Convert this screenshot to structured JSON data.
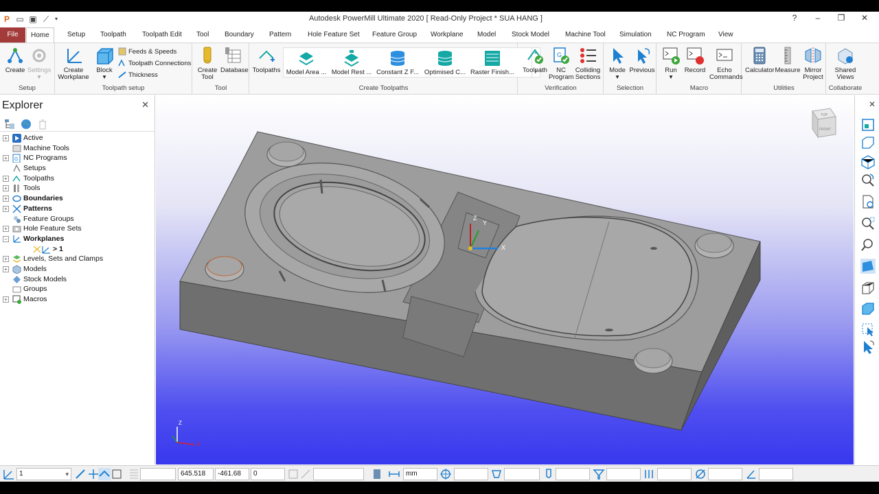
{
  "app": {
    "title": "Autodesk PowerMill Ultimate 2020    [ Read-Only Project * SUA HANG ]",
    "window_buttons": [
      "?",
      "–",
      "❐",
      "✕"
    ]
  },
  "tabs": [
    {
      "label": "File"
    },
    {
      "label": "Home"
    },
    {
      "label": "Setup"
    },
    {
      "label": "Toolpath"
    },
    {
      "label": "Toolpath Edit"
    },
    {
      "label": "Tool"
    },
    {
      "label": "Boundary"
    },
    {
      "label": "Pattern"
    },
    {
      "label": "Hole Feature Set"
    },
    {
      "label": "Feature Group"
    },
    {
      "label": "Workplane"
    },
    {
      "label": "Model"
    },
    {
      "label": "Stock Model"
    },
    {
      "label": "Machine Tool"
    },
    {
      "label": "Simulation"
    },
    {
      "label": "NC Program"
    },
    {
      "label": "View"
    }
  ],
  "ribbon": {
    "setup": {
      "label": "Setup",
      "create": "Create",
      "settings": "Settings"
    },
    "toolpath_setup": {
      "label": "Toolpath setup",
      "create_workplane": [
        "Create",
        "Workplane"
      ],
      "block": "Block",
      "feeds": "Feeds & Speeds",
      "connections": "Toolpath Connections",
      "thickness": "Thickness"
    },
    "tool": {
      "label": "Tool",
      "create_tool": [
        "Create",
        "Tool"
      ],
      "database": "Database"
    },
    "create_toolpaths": {
      "label": "Create Toolpaths",
      "toolpaths": "Toolpaths",
      "gallery": [
        "Model Area ...",
        "Model Rest ...",
        "Constant Z F...",
        "Optimised C...",
        "Raster Finish..."
      ]
    },
    "verification": {
      "label": "Verification",
      "toolpath": "Toolpath",
      "nc_program": [
        "NC",
        "Program"
      ],
      "colliding": [
        "Colliding",
        "Sections"
      ]
    },
    "selection": {
      "label": "Selection",
      "mode": "Mode",
      "previous": "Previous"
    },
    "macro": {
      "label": "Macro",
      "run": "Run",
      "record": "Record",
      "echo": [
        "Echo",
        "Commands"
      ]
    },
    "utilities": {
      "label": "Utilities",
      "calculator": "Calculator",
      "measure": "Measure",
      "mirror": [
        "Mirror",
        "Project"
      ]
    },
    "collaborate": {
      "label": "Collaborate",
      "shared": [
        "Shared",
        "Views"
      ]
    }
  },
  "explorer": {
    "title": "Explorer",
    "items": [
      {
        "label": "Active",
        "bold": false
      },
      {
        "label": "Machine Tools",
        "bold": false
      },
      {
        "label": "NC Programs",
        "bold": false
      },
      {
        "label": "Setups",
        "bold": false
      },
      {
        "label": "Toolpaths",
        "bold": false
      },
      {
        "label": "Tools",
        "bold": false
      },
      {
        "label": "Boundaries",
        "bold": true
      },
      {
        "label": "Patterns",
        "bold": true
      },
      {
        "label": "Feature Groups",
        "bold": false
      },
      {
        "label": "Hole Feature Sets",
        "bold": false
      },
      {
        "label": "Workplanes",
        "bold": true
      },
      {
        "label": "> 1",
        "bold": true
      },
      {
        "label": "Levels, Sets and Clamps",
        "bold": false
      },
      {
        "label": "Models",
        "bold": false
      },
      {
        "label": "Stock Models",
        "bold": false
      },
      {
        "label": "Groups",
        "bold": false
      },
      {
        "label": "Macros",
        "bold": false
      }
    ]
  },
  "viewport": {
    "viewcube_top": "TOP",
    "viewcube_front": "FRONT",
    "axis_x": "X",
    "axis_y": "Y",
    "axis_z": "Z"
  },
  "status": {
    "workplane": "1",
    "x": "645.518",
    "y": "-461.68",
    "z": "0",
    "units": "mm"
  },
  "colors": {
    "file_tab": "#a33b3b",
    "accent_blue": "#1f7fd0",
    "teal": "#14a9a5"
  }
}
